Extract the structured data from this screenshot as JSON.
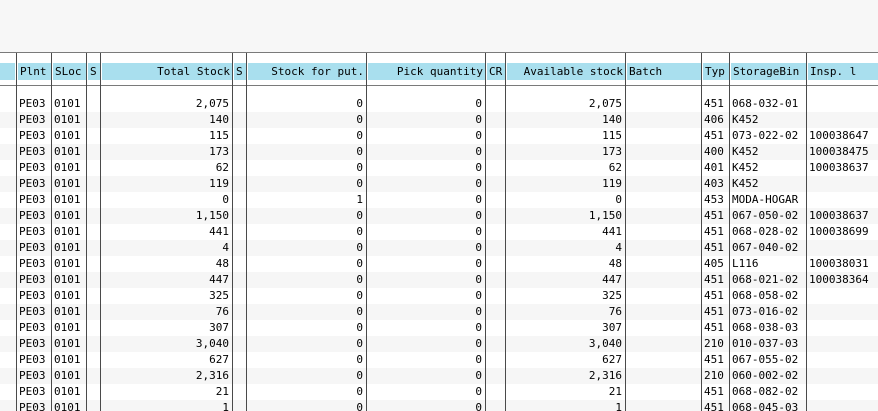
{
  "columns": [
    {
      "key": "c0",
      "label": "",
      "align": "l"
    },
    {
      "key": "plant",
      "label": "Plnt",
      "align": "l"
    },
    {
      "key": "sloc",
      "label": "SLoc",
      "align": "l"
    },
    {
      "key": "s1",
      "label": "S",
      "align": "l"
    },
    {
      "key": "total",
      "label": "Total Stock",
      "align": "r"
    },
    {
      "key": "s2",
      "label": "S",
      "align": "l"
    },
    {
      "key": "putaway",
      "label": "Stock for put.",
      "align": "r"
    },
    {
      "key": "pick",
      "label": "Pick quantity",
      "align": "r"
    },
    {
      "key": "cr",
      "label": "CR",
      "align": "l"
    },
    {
      "key": "avail",
      "label": "Available stock",
      "align": "r"
    },
    {
      "key": "batch",
      "label": "Batch",
      "align": "l"
    },
    {
      "key": "typ",
      "label": "Typ",
      "align": "l"
    },
    {
      "key": "bin",
      "label": "StorageBin",
      "align": "l"
    },
    {
      "key": "insp",
      "label": "Insp. l",
      "align": "l"
    }
  ],
  "rows": [
    {
      "plant": "PE03",
      "sloc": "0101",
      "total": "2,075",
      "putaway": "0",
      "pick": "0",
      "avail": "2,075",
      "typ": "451",
      "bin": "068-032-01",
      "insp": ""
    },
    {
      "plant": "PE03",
      "sloc": "0101",
      "total": "140",
      "putaway": "0",
      "pick": "0",
      "avail": "140",
      "typ": "406",
      "bin": "K452",
      "insp": ""
    },
    {
      "plant": "PE03",
      "sloc": "0101",
      "total": "115",
      "putaway": "0",
      "pick": "0",
      "avail": "115",
      "typ": "451",
      "bin": "073-022-02",
      "insp": "100038647"
    },
    {
      "plant": "PE03",
      "sloc": "0101",
      "total": "173",
      "putaway": "0",
      "pick": "0",
      "avail": "173",
      "typ": "400",
      "bin": "K452",
      "insp": "100038475"
    },
    {
      "plant": "PE03",
      "sloc": "0101",
      "total": "62",
      "putaway": "0",
      "pick": "0",
      "avail": "62",
      "typ": "401",
      "bin": "K452",
      "insp": "100038637"
    },
    {
      "plant": "PE03",
      "sloc": "0101",
      "total": "119",
      "putaway": "0",
      "pick": "0",
      "avail": "119",
      "typ": "403",
      "bin": "K452",
      "insp": ""
    },
    {
      "plant": "PE03",
      "sloc": "0101",
      "total": "0",
      "putaway": "1",
      "pick": "0",
      "avail": "0",
      "typ": "453",
      "bin": "MODA-HOGAR",
      "insp": ""
    },
    {
      "plant": "PE03",
      "sloc": "0101",
      "total": "1,150",
      "putaway": "0",
      "pick": "0",
      "avail": "1,150",
      "typ": "451",
      "bin": "067-050-02",
      "insp": "100038637"
    },
    {
      "plant": "PE03",
      "sloc": "0101",
      "total": "441",
      "putaway": "0",
      "pick": "0",
      "avail": "441",
      "typ": "451",
      "bin": "068-028-02",
      "insp": "100038699"
    },
    {
      "plant": "PE03",
      "sloc": "0101",
      "total": "4",
      "putaway": "0",
      "pick": "0",
      "avail": "4",
      "typ": "451",
      "bin": "067-040-02",
      "insp": ""
    },
    {
      "plant": "PE03",
      "sloc": "0101",
      "total": "48",
      "putaway": "0",
      "pick": "0",
      "avail": "48",
      "typ": "405",
      "bin": "L116",
      "insp": "100038031"
    },
    {
      "plant": "PE03",
      "sloc": "0101",
      "total": "447",
      "putaway": "0",
      "pick": "0",
      "avail": "447",
      "typ": "451",
      "bin": "068-021-02",
      "insp": "100038364"
    },
    {
      "plant": "PE03",
      "sloc": "0101",
      "total": "325",
      "putaway": "0",
      "pick": "0",
      "avail": "325",
      "typ": "451",
      "bin": "068-058-02",
      "insp": ""
    },
    {
      "plant": "PE03",
      "sloc": "0101",
      "total": "76",
      "putaway": "0",
      "pick": "0",
      "avail": "76",
      "typ": "451",
      "bin": "073-016-02",
      "insp": ""
    },
    {
      "plant": "PE03",
      "sloc": "0101",
      "total": "307",
      "putaway": "0",
      "pick": "0",
      "avail": "307",
      "typ": "451",
      "bin": "068-038-03",
      "insp": ""
    },
    {
      "plant": "PE03",
      "sloc": "0101",
      "total": "3,040",
      "putaway": "0",
      "pick": "0",
      "avail": "3,040",
      "typ": "210",
      "bin": "010-037-03",
      "insp": ""
    },
    {
      "plant": "PE03",
      "sloc": "0101",
      "total": "627",
      "putaway": "0",
      "pick": "0",
      "avail": "627",
      "typ": "451",
      "bin": "067-055-02",
      "insp": ""
    },
    {
      "plant": "PE03",
      "sloc": "0101",
      "total": "2,316",
      "putaway": "0",
      "pick": "0",
      "avail": "2,316",
      "typ": "210",
      "bin": "060-002-02",
      "insp": ""
    },
    {
      "plant": "PE03",
      "sloc": "0101",
      "total": "21",
      "putaway": "0",
      "pick": "0",
      "avail": "21",
      "typ": "451",
      "bin": "068-082-02",
      "insp": ""
    },
    {
      "plant": "PE03",
      "sloc": "0101",
      "total": "1",
      "putaway": "0",
      "pick": "0",
      "avail": "1",
      "typ": "451",
      "bin": "068-045-03",
      "insp": ""
    }
  ],
  "colors": {
    "header_bg": "#a9dfee",
    "grid_line": "#4a4a4a",
    "toolbar_bg": "#f7f7f7"
  }
}
